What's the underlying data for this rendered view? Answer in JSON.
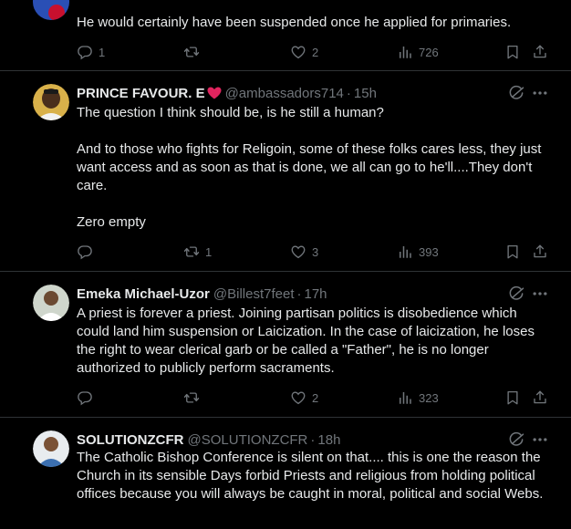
{
  "tweets": [
    {
      "text": [
        "He would certainly have been suspended once he applied for primaries."
      ],
      "replies": "1",
      "reposts": "",
      "likes": "2",
      "views": "726"
    },
    {
      "name": "PRINCE FAVOUR. E",
      "handle": "@ambassadors714",
      "time": "15h",
      "text": [
        "The question I think should be, is he still a human?",
        "And to those who fights for Religoin,  some of these folks cares less, they just want access and as soon as that is done, we all can go to he'll....They don't care.",
        "Zero empty"
      ],
      "replies": "",
      "reposts": "1",
      "likes": "3",
      "views": "393"
    },
    {
      "name": "Emeka Michael-Uzor",
      "handle": "@Billest7feet",
      "time": "17h",
      "text": [
        "A priest is forever a priest. Joining partisan politics is disobedience which could land him suspension or Laicization. In the case of laicization, he loses the right to wear clerical garb or be called a \"Father\", he is no longer authorized to publicly perform sacraments."
      ],
      "replies": "",
      "reposts": "",
      "likes": "2",
      "views": "323"
    },
    {
      "name": "SOLUTIONZCFR",
      "handle": "@SOLUTIONZCFR",
      "time": "18h",
      "text": [
        "The Catholic Bishop Conference is silent on that.... this is one the reason the Church in its sensible Days forbid Priests and religious from holding political offices because you will always be caught in moral, political and social Webs."
      ]
    }
  ],
  "colors": {
    "background": "#000000",
    "text": "#e7e9ea",
    "muted": "#71767b",
    "divider": "#2f3336",
    "heart": "#e0245e"
  },
  "icons": [
    "reply-icon",
    "repost-icon",
    "like-icon",
    "views-icon",
    "bookmark-icon",
    "share-icon",
    "grok-icon",
    "more-icon"
  ]
}
